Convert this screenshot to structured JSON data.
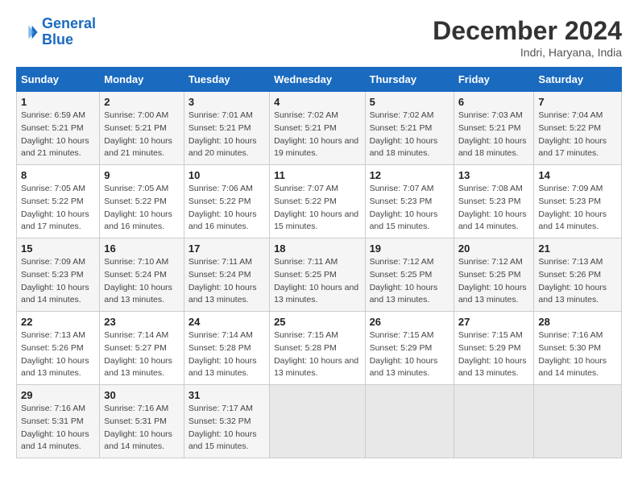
{
  "header": {
    "logo_line1": "General",
    "logo_line2": "Blue",
    "month": "December 2024",
    "location": "Indri, Haryana, India"
  },
  "weekdays": [
    "Sunday",
    "Monday",
    "Tuesday",
    "Wednesday",
    "Thursday",
    "Friday",
    "Saturday"
  ],
  "weeks": [
    [
      {
        "day": "1",
        "sunrise": "Sunrise: 6:59 AM",
        "sunset": "Sunset: 5:21 PM",
        "daylight": "Daylight: 10 hours and 21 minutes."
      },
      {
        "day": "2",
        "sunrise": "Sunrise: 7:00 AM",
        "sunset": "Sunset: 5:21 PM",
        "daylight": "Daylight: 10 hours and 21 minutes."
      },
      {
        "day": "3",
        "sunrise": "Sunrise: 7:01 AM",
        "sunset": "Sunset: 5:21 PM",
        "daylight": "Daylight: 10 hours and 20 minutes."
      },
      {
        "day": "4",
        "sunrise": "Sunrise: 7:02 AM",
        "sunset": "Sunset: 5:21 PM",
        "daylight": "Daylight: 10 hours and 19 minutes."
      },
      {
        "day": "5",
        "sunrise": "Sunrise: 7:02 AM",
        "sunset": "Sunset: 5:21 PM",
        "daylight": "Daylight: 10 hours and 18 minutes."
      },
      {
        "day": "6",
        "sunrise": "Sunrise: 7:03 AM",
        "sunset": "Sunset: 5:21 PM",
        "daylight": "Daylight: 10 hours and 18 minutes."
      },
      {
        "day": "7",
        "sunrise": "Sunrise: 7:04 AM",
        "sunset": "Sunset: 5:22 PM",
        "daylight": "Daylight: 10 hours and 17 minutes."
      }
    ],
    [
      {
        "day": "8",
        "sunrise": "Sunrise: 7:05 AM",
        "sunset": "Sunset: 5:22 PM",
        "daylight": "Daylight: 10 hours and 17 minutes."
      },
      {
        "day": "9",
        "sunrise": "Sunrise: 7:05 AM",
        "sunset": "Sunset: 5:22 PM",
        "daylight": "Daylight: 10 hours and 16 minutes."
      },
      {
        "day": "10",
        "sunrise": "Sunrise: 7:06 AM",
        "sunset": "Sunset: 5:22 PM",
        "daylight": "Daylight: 10 hours and 16 minutes."
      },
      {
        "day": "11",
        "sunrise": "Sunrise: 7:07 AM",
        "sunset": "Sunset: 5:22 PM",
        "daylight": "Daylight: 10 hours and 15 minutes."
      },
      {
        "day": "12",
        "sunrise": "Sunrise: 7:07 AM",
        "sunset": "Sunset: 5:23 PM",
        "daylight": "Daylight: 10 hours and 15 minutes."
      },
      {
        "day": "13",
        "sunrise": "Sunrise: 7:08 AM",
        "sunset": "Sunset: 5:23 PM",
        "daylight": "Daylight: 10 hours and 14 minutes."
      },
      {
        "day": "14",
        "sunrise": "Sunrise: 7:09 AM",
        "sunset": "Sunset: 5:23 PM",
        "daylight": "Daylight: 10 hours and 14 minutes."
      }
    ],
    [
      {
        "day": "15",
        "sunrise": "Sunrise: 7:09 AM",
        "sunset": "Sunset: 5:23 PM",
        "daylight": "Daylight: 10 hours and 14 minutes."
      },
      {
        "day": "16",
        "sunrise": "Sunrise: 7:10 AM",
        "sunset": "Sunset: 5:24 PM",
        "daylight": "Daylight: 10 hours and 13 minutes."
      },
      {
        "day": "17",
        "sunrise": "Sunrise: 7:11 AM",
        "sunset": "Sunset: 5:24 PM",
        "daylight": "Daylight: 10 hours and 13 minutes."
      },
      {
        "day": "18",
        "sunrise": "Sunrise: 7:11 AM",
        "sunset": "Sunset: 5:25 PM",
        "daylight": "Daylight: 10 hours and 13 minutes."
      },
      {
        "day": "19",
        "sunrise": "Sunrise: 7:12 AM",
        "sunset": "Sunset: 5:25 PM",
        "daylight": "Daylight: 10 hours and 13 minutes."
      },
      {
        "day": "20",
        "sunrise": "Sunrise: 7:12 AM",
        "sunset": "Sunset: 5:25 PM",
        "daylight": "Daylight: 10 hours and 13 minutes."
      },
      {
        "day": "21",
        "sunrise": "Sunrise: 7:13 AM",
        "sunset": "Sunset: 5:26 PM",
        "daylight": "Daylight: 10 hours and 13 minutes."
      }
    ],
    [
      {
        "day": "22",
        "sunrise": "Sunrise: 7:13 AM",
        "sunset": "Sunset: 5:26 PM",
        "daylight": "Daylight: 10 hours and 13 minutes."
      },
      {
        "day": "23",
        "sunrise": "Sunrise: 7:14 AM",
        "sunset": "Sunset: 5:27 PM",
        "daylight": "Daylight: 10 hours and 13 minutes."
      },
      {
        "day": "24",
        "sunrise": "Sunrise: 7:14 AM",
        "sunset": "Sunset: 5:28 PM",
        "daylight": "Daylight: 10 hours and 13 minutes."
      },
      {
        "day": "25",
        "sunrise": "Sunrise: 7:15 AM",
        "sunset": "Sunset: 5:28 PM",
        "daylight": "Daylight: 10 hours and 13 minutes."
      },
      {
        "day": "26",
        "sunrise": "Sunrise: 7:15 AM",
        "sunset": "Sunset: 5:29 PM",
        "daylight": "Daylight: 10 hours and 13 minutes."
      },
      {
        "day": "27",
        "sunrise": "Sunrise: 7:15 AM",
        "sunset": "Sunset: 5:29 PM",
        "daylight": "Daylight: 10 hours and 13 minutes."
      },
      {
        "day": "28",
        "sunrise": "Sunrise: 7:16 AM",
        "sunset": "Sunset: 5:30 PM",
        "daylight": "Daylight: 10 hours and 14 minutes."
      }
    ],
    [
      {
        "day": "29",
        "sunrise": "Sunrise: 7:16 AM",
        "sunset": "Sunset: 5:31 PM",
        "daylight": "Daylight: 10 hours and 14 minutes."
      },
      {
        "day": "30",
        "sunrise": "Sunrise: 7:16 AM",
        "sunset": "Sunset: 5:31 PM",
        "daylight": "Daylight: 10 hours and 14 minutes."
      },
      {
        "day": "31",
        "sunrise": "Sunrise: 7:17 AM",
        "sunset": "Sunset: 5:32 PM",
        "daylight": "Daylight: 10 hours and 15 minutes."
      },
      null,
      null,
      null,
      null
    ]
  ]
}
